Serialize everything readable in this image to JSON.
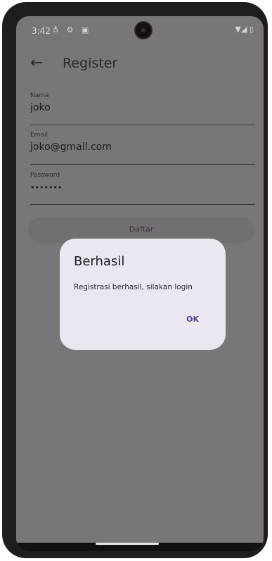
{
  "status_bar": {
    "time": "3:42",
    "left_icons": "♁ ⚙ ▣",
    "right_icons": "▼◢ ▯"
  },
  "app_bar": {
    "title": "Register",
    "back_icon": "←"
  },
  "form": {
    "fields": [
      {
        "label": "Nama",
        "value": "joko"
      },
      {
        "label": "Email",
        "value": "joko@gmail.com"
      },
      {
        "label": "Password",
        "value": "•••••••"
      }
    ],
    "submit_label": "Daftar"
  },
  "dialog": {
    "title": "Berhasil",
    "message": "Registrasi berhasil, silakan login",
    "ok_label": "OK"
  },
  "colors": {
    "scrim_background": "#7a7677",
    "dialog_background": "#ece6f0",
    "accent": "#5a3d8f"
  }
}
